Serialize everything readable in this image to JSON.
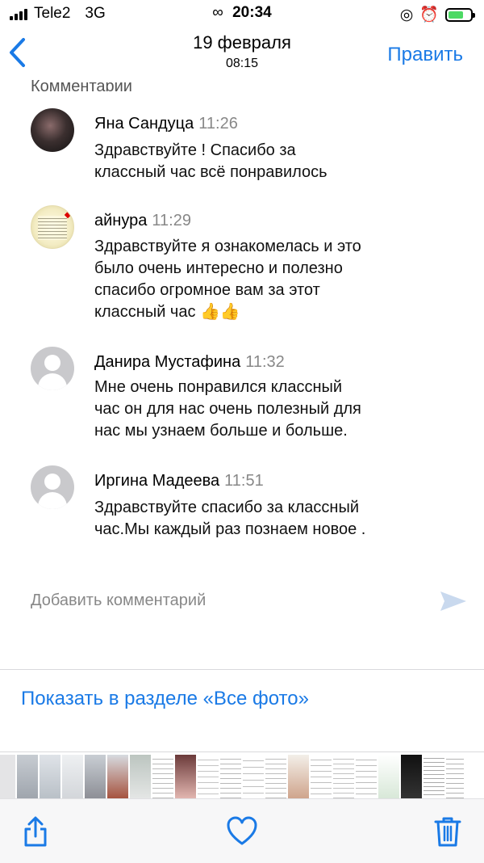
{
  "status_bar": {
    "carrier": "Tele2",
    "network": "3G",
    "time": "20:34"
  },
  "nav": {
    "back_icon": "chevron-left-icon",
    "title": "19 февраля",
    "subtitle": "08:15",
    "edit_label": "Править"
  },
  "section_header": "Комментарии",
  "comments": [
    {
      "author": "Яна Сандуца",
      "time": "11:26",
      "lines": [
        "Здравствуйте ! Спасибо за",
        "классный час всё понравилось"
      ]
    },
    {
      "author": "айнура",
      "time": "11:29",
      "lines": [
        "Здравствуйте я ознакомелась и это",
        "было очень интересно и полезно",
        "спасибо огромное вам за этот",
        "классный час 👍👍"
      ]
    },
    {
      "author": "Данира Мустафина",
      "time": "11:32",
      "lines": [
        "Мне очень понравился  классный",
        "час он для нас очень полезный для",
        "нас мы узнаем  больше и больше."
      ]
    },
    {
      "author": "Иргина Мадеева",
      "time": "11:51",
      "lines": [
        "Здравствуйте спасибо за классный",
        "час.Мы каждый раз познаем новое ."
      ]
    }
  ],
  "add_comment_placeholder": "Добавить комментарий",
  "show_all_link": "Показать в разделе «Все фото»",
  "colors": {
    "accent": "#1a7ae6",
    "secondary_text": "#888888"
  },
  "toolbar": {
    "icons": [
      "share-icon",
      "heart-icon",
      "trash-icon"
    ]
  }
}
